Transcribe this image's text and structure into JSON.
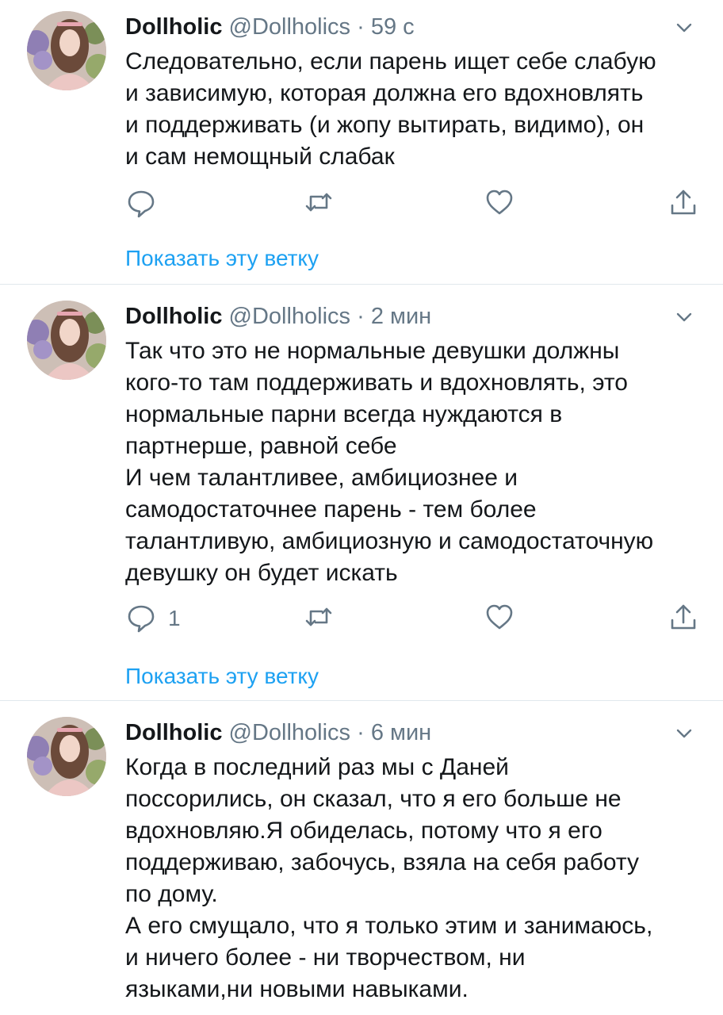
{
  "accent_color": "#1da1f2",
  "icons": [
    "reply-icon",
    "retweet-icon",
    "like-icon",
    "share-icon",
    "chevron-down-icon"
  ],
  "tweets": [
    {
      "name": "Dollholic",
      "handle": "@Dollholics",
      "separator": "·",
      "time": "59 с",
      "text": "Следовательно, если парень ищет себе слабую\nи зависимую, которая должна его вдохновлять\nи поддерживать (и жопу вытирать,  видимо), он\nи сам немощный слабак",
      "reply_count": "",
      "thread_link": "Показать эту ветку"
    },
    {
      "name": "Dollholic",
      "handle": "@Dollholics",
      "separator": "·",
      "time": "2 мин",
      "text": "Так что это не нормальные девушки должны\nкого-то там поддерживать и вдохновлять, это\nнормальные парни всегда нуждаются в\nпартнерше, равной себе\nИ чем талантливее, амбициознее и\nсамодостаточнее парень - тем более\nталантливую, амбициозную и самодостаточную\nдевушку он будет искать",
      "reply_count": "1",
      "thread_link": "Показать эту ветку"
    },
    {
      "name": "Dollholic",
      "handle": "@Dollholics",
      "separator": "·",
      "time": "6 мин",
      "text": "Когда в последний раз мы с Даней\nпоссорились, он сказал, что я его больше не\nвдохновляю.Я обиделась, потому что я его\nподдерживаю, забочусь, взяла на себя работу\nпо дому.\nА его смущало, что я только этим и занимаюсь,\nи ничего более - ни творчеством, ни\nязыками,ни новыми навыками."
    }
  ]
}
